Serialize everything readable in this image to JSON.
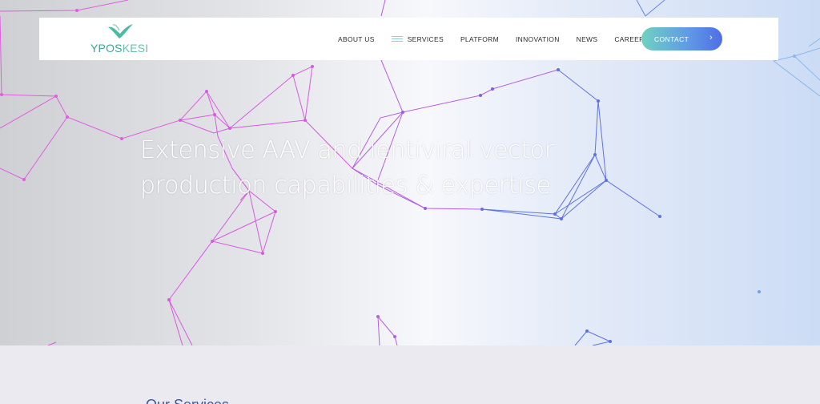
{
  "brand": {
    "logo_text_a": "YPOS",
    "logo_text_b": "KESI"
  },
  "nav": {
    "items": [
      {
        "label": "ABOUT US"
      },
      {
        "label": "SERVICES"
      },
      {
        "label": "PLATFORM"
      },
      {
        "label": "INNOVATION"
      },
      {
        "label": "NEWS"
      },
      {
        "label": "CAREERS"
      }
    ],
    "contact_label": "CONTACT",
    "contact_icon": "chevron-right-icon"
  },
  "hero": {
    "headline_line1": "Extensive AAV and lentiviral vector",
    "headline_line2": "production capabilities & expertise"
  },
  "section": {
    "title": "Our Services"
  },
  "colors": {
    "accent_teal": "#6fd2c2",
    "accent_blue": "#4f6ee6",
    "network_pink": "#e25be0",
    "network_violet": "#b25fe0",
    "network_blue": "#5a6fe0",
    "network_sky": "#8ab8ee"
  }
}
